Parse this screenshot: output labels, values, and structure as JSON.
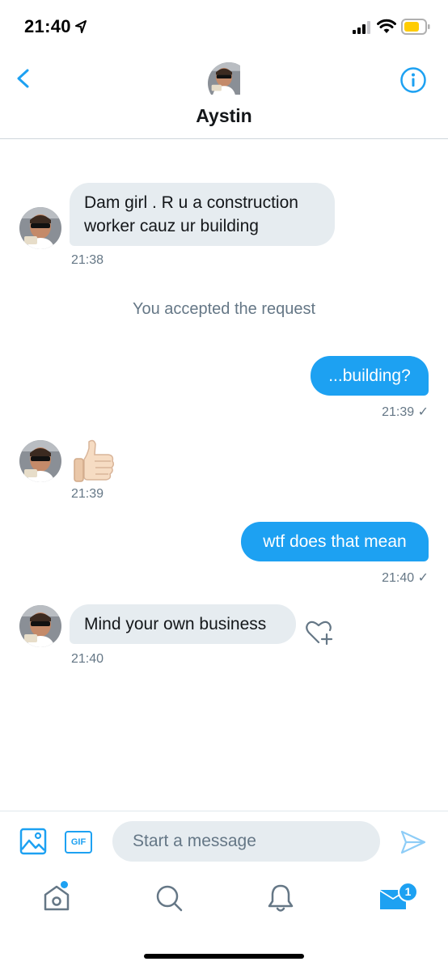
{
  "status_bar": {
    "time": "21:40",
    "icons": [
      "location-arrow-icon",
      "signal-icon",
      "wifi-icon",
      "battery-icon"
    ],
    "battery_color": "#ffcc00"
  },
  "header": {
    "name": "Aystin",
    "back_icon": "chevron-left-icon",
    "info_icon": "info-icon"
  },
  "messages": [
    {
      "id": "m1",
      "direction": "in",
      "text_lines": [
        "Dam girl . R u a construction",
        "worker cauz ur building"
      ],
      "time": "21:38"
    },
    {
      "id": "sys",
      "type": "system",
      "text": "You accepted the request"
    },
    {
      "id": "m2",
      "direction": "out",
      "text": "...building?",
      "time": "21:39",
      "status": "✓"
    },
    {
      "id": "m3",
      "direction": "in",
      "emoji": "thumbs-up",
      "time": "21:39"
    },
    {
      "id": "m4",
      "direction": "out",
      "text": "wtf does that mean",
      "time": "21:40",
      "status": "✓"
    },
    {
      "id": "m5",
      "direction": "in",
      "text": "Mind your own business",
      "time": "21:40"
    }
  ],
  "composer": {
    "placeholder": "Start a message",
    "gif_label": "GIF"
  },
  "tabbar": {
    "tabs": [
      "home",
      "search",
      "notifications",
      "messages"
    ],
    "messages_badge": "1"
  },
  "colors": {
    "accent": "#1da1f2",
    "incoming_bubble": "#e6ecf0",
    "secondary_text": "#657786"
  }
}
